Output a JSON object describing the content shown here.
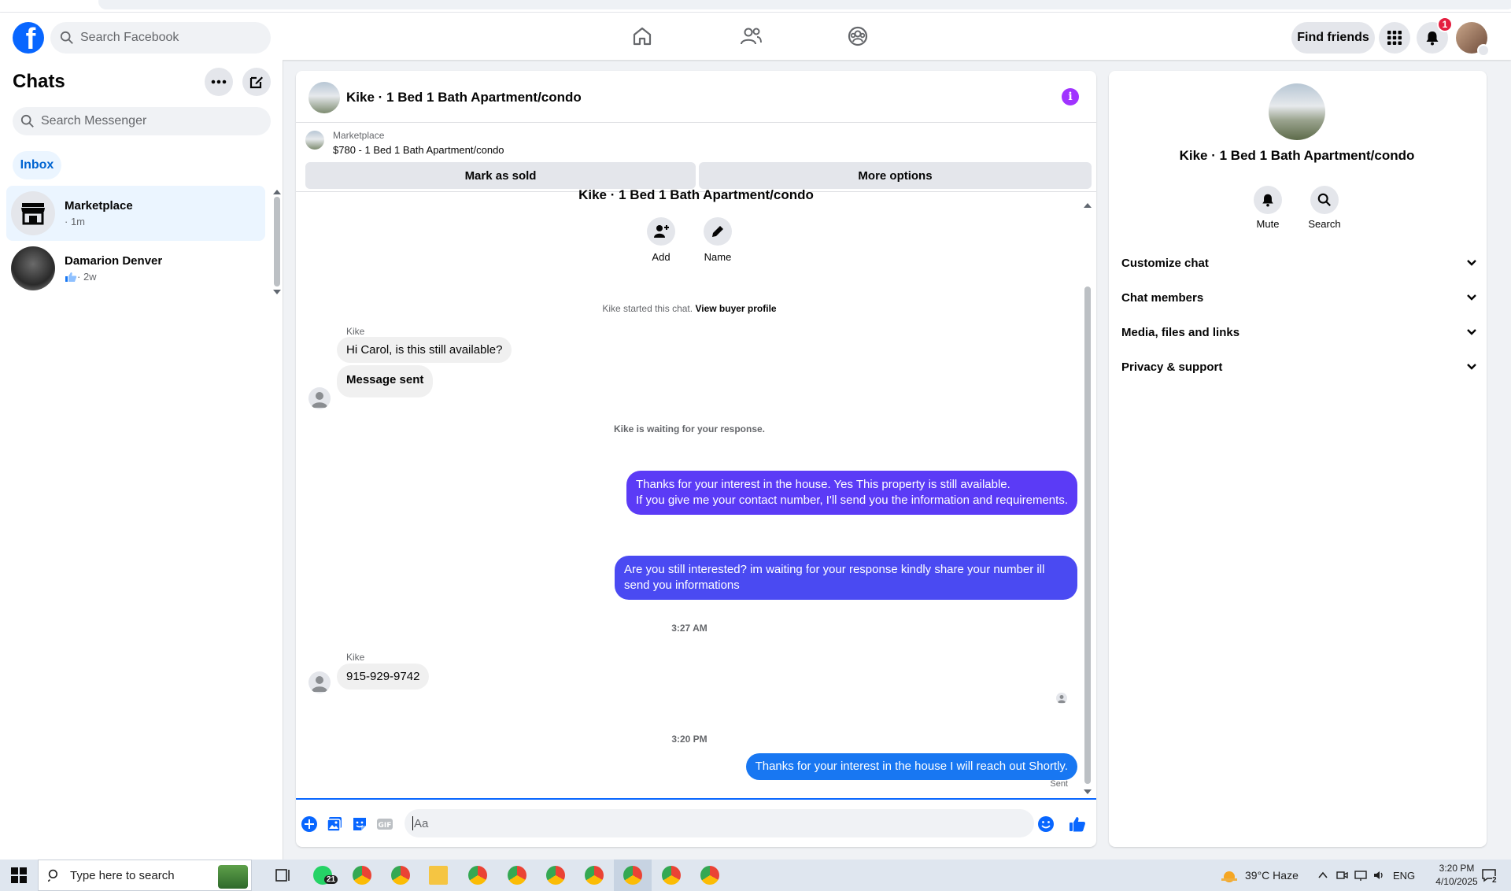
{
  "nav": {
    "search_placeholder": "Search Facebook",
    "find_friends": "Find friends",
    "notification_count": "1"
  },
  "chats": {
    "title": "Chats",
    "search_placeholder": "Search Messenger",
    "inbox_tab": "Inbox",
    "items": [
      {
        "name": "Marketplace",
        "sub": "· 1m"
      },
      {
        "name": "Damarion Denver",
        "sub": "· 2w"
      }
    ]
  },
  "conversation": {
    "title": "Kike · 1 Bed 1 Bath Apartment/condo",
    "marketplace_label": "Marketplace",
    "listing": "$780 - 1 Bed 1 Bath Apartment/condo",
    "mark_sold": "Mark as sold",
    "more_options": "More options",
    "header_title_repeat": "Kike · 1 Bed 1 Bath Apartment/condo",
    "add_label": "Add",
    "name_label": "Name",
    "started_text": "Kike started this chat.",
    "view_buyer": "View buyer profile",
    "sender1": "Kike",
    "msg1": "Hi Carol, is this still available?",
    "msg2": "Message sent",
    "waiting": "Kike is waiting for your response.",
    "out1_line1": "Thanks for your interest in the house. Yes This property is still available.",
    "out1_line2": "If you give me your contact number, I'll send you the information and requirements.",
    "out2_line1": "Are you still interested? im waiting for your response kindly share your number ill",
    "out2_line2": "send you informations",
    "time1": "3:27 AM",
    "sender2": "Kike",
    "msg3": "915-929-9742",
    "time2": "3:20 PM",
    "out3": "Thanks for your interest in the house I will reach out Shortly.",
    "sent_status": "Sent",
    "composer_placeholder": "Aa"
  },
  "details": {
    "name": "Kike · 1 Bed 1 Bath Apartment/condo",
    "mute": "Mute",
    "search": "Search",
    "sections": [
      "Customize chat",
      "Chat members",
      "Media, files and links",
      "Privacy & support"
    ]
  },
  "taskbar": {
    "search_placeholder": "Type here to search",
    "whatsapp_badge": "21",
    "weather": "39°C  Haze",
    "lang": "ENG",
    "time": "3:20 PM",
    "date": "4/10/2025",
    "notif_count": "2"
  },
  "colors": {
    "fb_blue": "#0866ff",
    "out_bubble_purple": "#5b3bf6",
    "out_bubble_indigo": "#4a4af2",
    "out_bubble_blue": "#1877f2",
    "info_purple": "#a033ff"
  }
}
